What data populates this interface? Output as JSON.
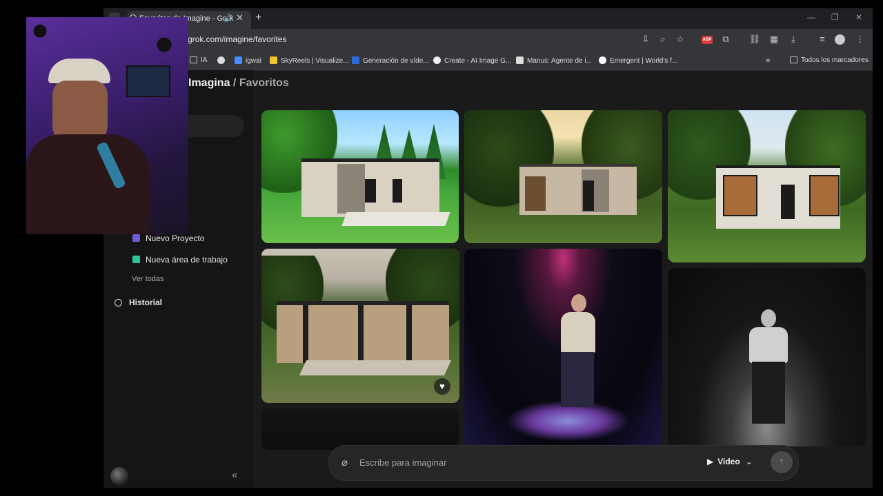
{
  "browser": {
    "tab_title": "Favoritos de Imagine - Grok",
    "url": "grok.com/imagine/favorites",
    "new_tab_icon": "plus-icon",
    "bookmarks": [
      {
        "label": "IA",
        "icon": "folder-icon"
      },
      {
        "label": "",
        "icon": "globe-icon"
      },
      {
        "label": "igwai",
        "icon": "igwai-icon"
      },
      {
        "label": "SkyReels | Visualize...",
        "icon": "skyreels-icon"
      },
      {
        "label": "Generación de víde...",
        "icon": "vidu-icon"
      },
      {
        "label": "Create - AI Image G...",
        "icon": "create-icon"
      },
      {
        "label": "Manus: Agente de i...",
        "icon": "manus-icon"
      },
      {
        "label": "Emergent | World's f...",
        "icon": "emergent-icon"
      }
    ],
    "all_bookmarks": "Todos los marcadores"
  },
  "sidebar": {
    "items": [
      {
        "label": "Nuevo Proyecto",
        "icon": "project-icon",
        "color": "#6a5fd8"
      },
      {
        "label": "Nueva área de trabajo",
        "icon": "workspace-icon",
        "color": "#2fc39a"
      }
    ],
    "see_all": "Ver todas",
    "history": "Historial"
  },
  "main": {
    "breadcrumb_root": "Imagina",
    "breadcrumb_separator": "/",
    "breadcrumb_current": "Favoritos"
  },
  "prompt": {
    "placeholder": "Escribe para imaginar",
    "mode": "Video"
  },
  "colors": {
    "background": "#1a1a1b",
    "sidebar": "#151516",
    "browser_chrome": "#35363a"
  }
}
